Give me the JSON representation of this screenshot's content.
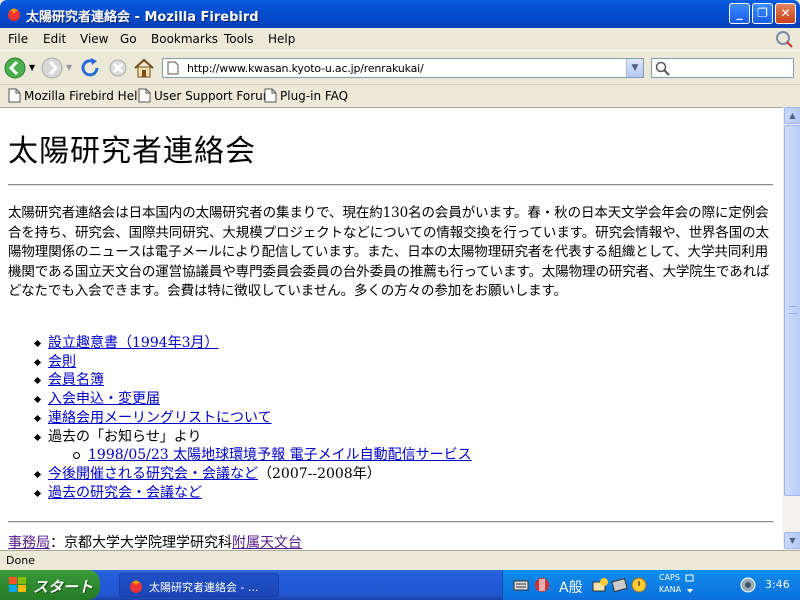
{
  "window": {
    "title": "太陽研究者連絡会 - Mozilla Firebird"
  },
  "menu": [
    "File",
    "Edit",
    "View",
    "Go",
    "Bookmarks",
    "Tools",
    "Help"
  ],
  "nav": {
    "url": "http://www.kwasan.kyoto-u.ac.jp/renrakukai/",
    "search_value": ""
  },
  "bookmarks": [
    "Mozilla Firebird Help",
    "User Support Forum",
    "Plug-in FAQ"
  ],
  "page": {
    "heading": "太陽研究者連絡会",
    "intro": "太陽研究者連絡会は日本国内の太陽研究者の集まりで、現在約130名の会員がいます。春・秋の日本天文学会年会の際に定例会合を持ち、研究会、国際共同研究、大規模プロジェクトなどについての情報交換を行っています。研究会情報や、世界各国の太陽物理関係のニュースは電子メールにより配信しています。また、日本の太陽物理研究者を代表する組織として、大学共同利用機関である国立天文台の運営協議員や専門委員会委員の台外委員の推薦も行っています。太陽物理の研究者、大学院生であればどなたでも入会できます。会費は特に徴収していません。多くの方々の参加をお願いします。",
    "links": {
      "item1": "設立趣意書（1994年3月）",
      "item2": "会則",
      "item3": "会員名簿",
      "item4": "入会申込・変更届",
      "item5": "連絡会用メーリングリストについて",
      "item6": "過去の「お知らせ」より",
      "sub1": "1998/05/23 太陽地球環境予報 電子メイル自動配信サービス",
      "item7_link": "今後開催される研究会・会議など",
      "item7_suffix": "（2007--2008年）",
      "item8": "過去の研究会・会議など"
    },
    "footer": {
      "office_link": "事務局",
      "office_text": "：京都大学大学院理学研究科",
      "obs_link": "附属天文台"
    }
  },
  "status": "Done",
  "taskbar": {
    "start": "スタート",
    "task": "太陽研究者連絡会 - ...",
    "ime_mode": "A般",
    "caps": "CAPS",
    "kana": "KANA",
    "clock": "3:46"
  }
}
